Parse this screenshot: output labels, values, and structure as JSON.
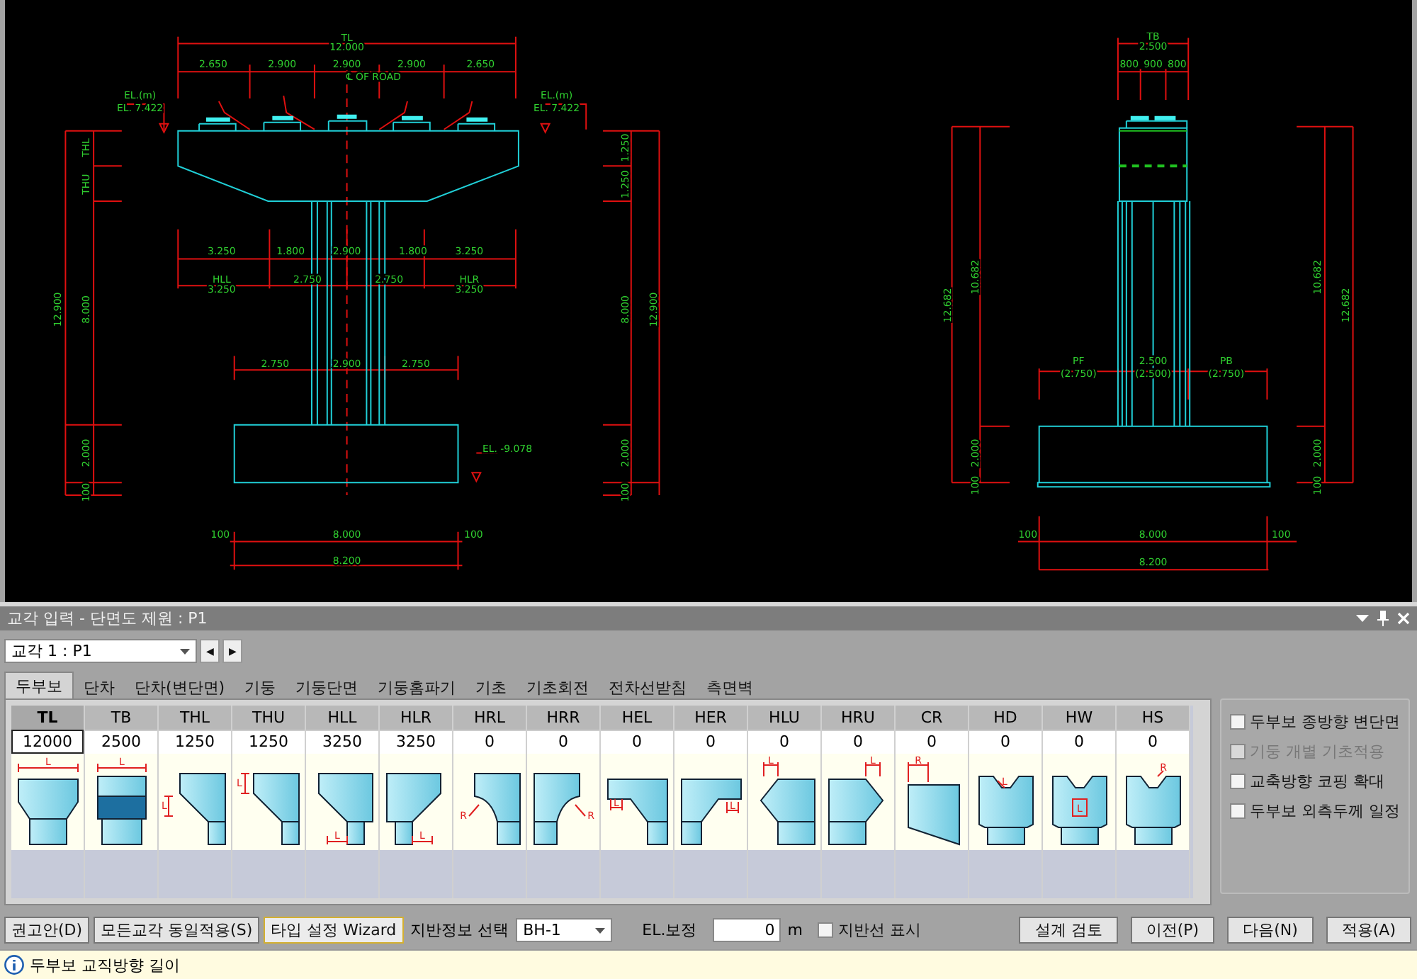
{
  "drawing_labels": [
    "TL",
    "12.000",
    "2.650",
    "2.900",
    "2.900",
    "2.900",
    "2.650",
    "℄ OF ROAD",
    "EL.(m)",
    "EL. 7.422",
    "EL.(m)",
    "EL. 7.422",
    "3.250",
    "1.800",
    "2.900",
    "1.800",
    "3.250",
    "HLL",
    "3.250",
    "2.750",
    "2.750",
    "HLR",
    "3.250",
    "2.750",
    "2.900",
    "2.750",
    "EL. -9.078",
    "THL",
    "THU",
    "12.900",
    "8.000",
    "2.000",
    "100",
    "1.250",
    "1.250",
    "12.900",
    "8.000",
    "2.000",
    "100",
    "100",
    "8.000",
    "100",
    "8.200",
    "TB",
    "2.500",
    "800",
    "900",
    "800",
    "10.682",
    "12.682",
    "10.682",
    "12.682",
    "PF",
    "2.500",
    "PB",
    "(2.750)",
    "(2.500)",
    "(2.750)",
    "2.000",
    "100",
    "2.000",
    "100",
    "100",
    "8.000",
    "100",
    "8.200"
  ],
  "panel": {
    "title": "교각 입력 - 단면도 제원 : P1",
    "pier_select": {
      "value": "교각 1 : P1"
    },
    "prev_icon": "◀",
    "next_icon": "▶"
  },
  "tabs": [
    {
      "label": "두부보",
      "selected": true
    },
    {
      "label": "단차",
      "selected": false
    },
    {
      "label": "단차(변단면)",
      "selected": false
    },
    {
      "label": "기둥",
      "selected": false
    },
    {
      "label": "기둥단면",
      "selected": false
    },
    {
      "label": "기둥홈파기",
      "selected": false
    },
    {
      "label": "기초",
      "selected": false
    },
    {
      "label": "기초회전",
      "selected": false
    },
    {
      "label": "전차선받침",
      "selected": false
    },
    {
      "label": "측면벽",
      "selected": false
    }
  ],
  "columns": [
    {
      "label": "TL",
      "value": "12000",
      "kind": "taper",
      "symbol": "L",
      "selected": true
    },
    {
      "label": "TB",
      "value": "2500",
      "kind": "band",
      "symbol": "L",
      "selected": false
    },
    {
      "label": "THL",
      "value": "1250",
      "kind": "slope-l",
      "symbol": "L",
      "selected": false
    },
    {
      "label": "THU",
      "value": "1250",
      "kind": "slope-u",
      "symbol": "L",
      "selected": false
    },
    {
      "label": "HLL",
      "value": "3250",
      "kind": "chamfer-l",
      "symbol": "L",
      "selected": false
    },
    {
      "label": "HLR",
      "value": "3250",
      "kind": "chamfer-r",
      "symbol": "L",
      "selected": false
    },
    {
      "label": "HRL",
      "value": "0",
      "kind": "round-l",
      "symbol": "R",
      "selected": false
    },
    {
      "label": "HRR",
      "value": "0",
      "kind": "round-r",
      "symbol": "R",
      "selected": false
    },
    {
      "label": "HEL",
      "value": "0",
      "kind": "step-l",
      "symbol": "L",
      "selected": false
    },
    {
      "label": "HER",
      "value": "0",
      "kind": "step-r",
      "symbol": "L",
      "selected": false
    },
    {
      "label": "HLU",
      "value": "0",
      "kind": "hex-l",
      "symbol": "L",
      "selected": false
    },
    {
      "label": "HRU",
      "value": "0",
      "kind": "hex-r",
      "symbol": "L",
      "selected": false
    },
    {
      "label": "CR",
      "value": "0",
      "kind": "cr",
      "symbol": "R",
      "selected": false
    },
    {
      "label": "HD",
      "value": "0",
      "kind": "hd",
      "symbol": "L",
      "selected": false
    },
    {
      "label": "HW",
      "value": "0",
      "kind": "hw",
      "symbol": "L",
      "selected": false
    },
    {
      "label": "HS",
      "value": "0",
      "kind": "hs",
      "symbol": "R",
      "selected": false
    }
  ],
  "options": [
    {
      "label": "두부보 종방향 변단면",
      "checked": false,
      "disabled": false
    },
    {
      "label": "기둥 개별 기초적용",
      "checked": false,
      "disabled": true
    },
    {
      "label": "교축방향 코핑 확대",
      "checked": false,
      "disabled": false
    },
    {
      "label": "두부보 외측두께 일정",
      "checked": false,
      "disabled": false
    }
  ],
  "footer": {
    "recommend_button": "권고안(D)",
    "apply_all_button": "모든교각 동일적용(S)",
    "wizard_button": "타입 설정 Wizard",
    "ground_label": "지반정보 선택",
    "ground_select": "BH-1",
    "el_label": "EL.보정",
    "el_value": "0",
    "el_unit": "m",
    "ground_line": {
      "label": "지반선 표시",
      "checked": false
    },
    "right_buttons": [
      "설계 검토",
      "이전(P)",
      "다음(N)",
      "적용(A)"
    ]
  },
  "status": {
    "text": "두부보 교직방향 길이"
  }
}
